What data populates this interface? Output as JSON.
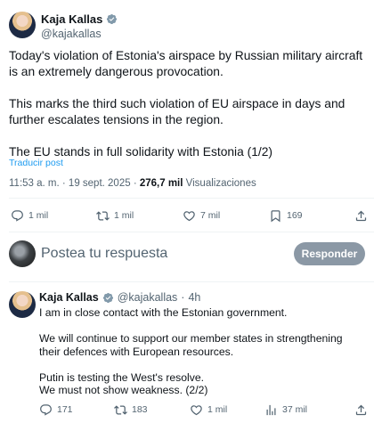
{
  "tweet": {
    "name": "Kaja Kallas",
    "handle": "@kajakallas",
    "text": "Today's violation of Estonia's airspace by Russian military aircraft is an extremely dangerous provocation.\n\nThis marks the third such violation of EU airspace in days and further escalates tensions in the region.\n\nThe EU stands in full solidarity with Estonia (1/2)",
    "translate": "Traducir post",
    "time": "11:53 a. m.",
    "date": "19 sept. 2025",
    "views_count": "276,7 mil",
    "views_label": "Visualizaciones",
    "actions": {
      "replies": "1 mil",
      "reposts": "1 mil",
      "likes": "7 mil",
      "bookmarks": "169"
    }
  },
  "reply_box": {
    "placeholder": "Postea tu respuesta",
    "button": "Responder"
  },
  "reply_tweet": {
    "name": "Kaja Kallas",
    "handle": "@kajakallas",
    "time": "4h",
    "text": "I am in close contact with the Estonian government.\n\nWe will continue to support our member states in strengthening their defences with European resources.\n\nPutin is testing the West's resolve.\nWe must not show weakness. (2/2)",
    "actions": {
      "replies": "171",
      "reposts": "183",
      "likes": "1 mil",
      "views": "37 mil"
    }
  },
  "colors": {
    "accent": "#1d9bf0",
    "muted": "#536471",
    "button_bg": "#8b98a5"
  }
}
